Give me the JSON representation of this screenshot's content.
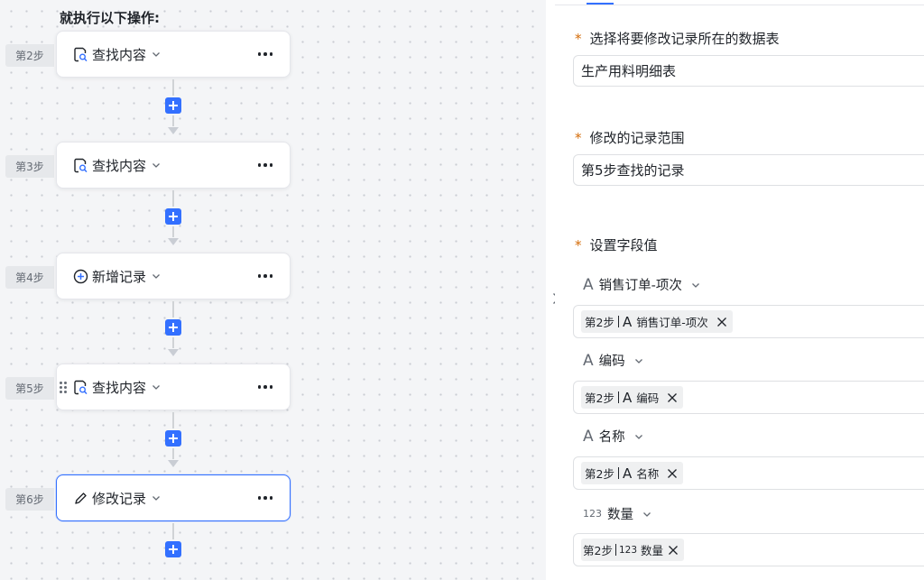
{
  "canvas": {
    "title": "就执行以下操作:",
    "steps": [
      {
        "label": "第2步",
        "name": "查找内容",
        "icon": "find-record-icon"
      },
      {
        "label": "第3步",
        "name": "查找内容",
        "icon": "find-record-icon"
      },
      {
        "label": "第4步",
        "name": "新增记录",
        "icon": "add-circle-icon"
      },
      {
        "label": "第5步",
        "name": "查找内容",
        "icon": "find-record-icon"
      },
      {
        "label": "第6步",
        "name": "修改记录",
        "icon": "edit-pencil-icon"
      }
    ]
  },
  "panel": {
    "table_field": {
      "label": "选择将要修改记录所在的数据表",
      "value": "生产用料明细表"
    },
    "range_field": {
      "label": "修改的记录范围",
      "value": "第5步查找的记录"
    },
    "set_values": {
      "label": "设置字段值",
      "fields": [
        {
          "type_icon": "A",
          "name": "销售订单-项次",
          "tag_step": "第2步",
          "tag_type": "A",
          "tag_name": "销售订单-项次"
        },
        {
          "type_icon": "A",
          "name": "编码",
          "tag_step": "第2步",
          "tag_type": "A",
          "tag_name": "编码"
        },
        {
          "type_icon": "A",
          "name": "名称",
          "tag_step": "第2步",
          "tag_type": "A",
          "tag_name": "名称"
        },
        {
          "type_icon": "123",
          "name": "数量",
          "tag_step": "第2步",
          "tag_type": "123",
          "tag_name": "数量"
        }
      ]
    }
  },
  "colors": {
    "accent": "#3370ff",
    "required": "#d46b08",
    "canvas_bg": "#f4f5f7"
  }
}
